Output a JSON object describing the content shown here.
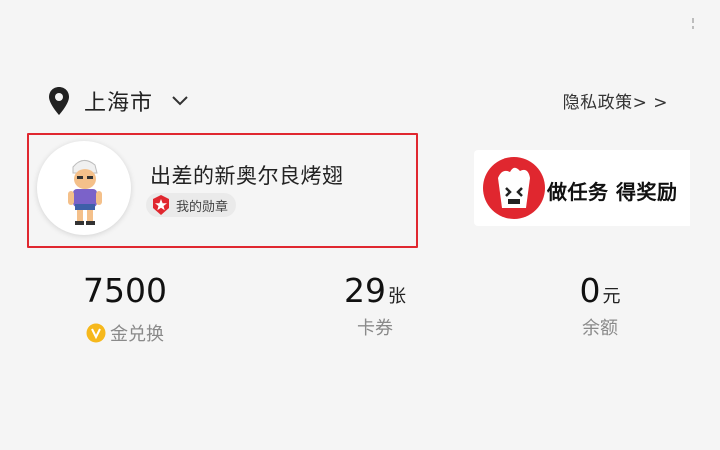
{
  "location": {
    "city": "上海市",
    "icon": "location-pin-icon"
  },
  "privacy_link": "隐私政策> >",
  "user": {
    "nickname": "出差的新奥尔良烤翅",
    "badge_label": "我的勋章",
    "avatar_icon": "cartoon-avatar",
    "highlight_color": "#e0272f"
  },
  "task_banner": {
    "label": "做任务 得奖励",
    "icon": "popcorn-bucket-icon"
  },
  "stats": {
    "gold": {
      "value": "7500",
      "label": "金兑换",
      "icon": "gold-coin-icon"
    },
    "coupons": {
      "value": "29",
      "unit": "张",
      "label": "卡券"
    },
    "balance": {
      "value": "0",
      "unit": "元",
      "label": "余额"
    }
  },
  "colors": {
    "background": "#f5f5f5",
    "accent_red": "#e0272f",
    "coin_gold": "#f6b81c"
  }
}
